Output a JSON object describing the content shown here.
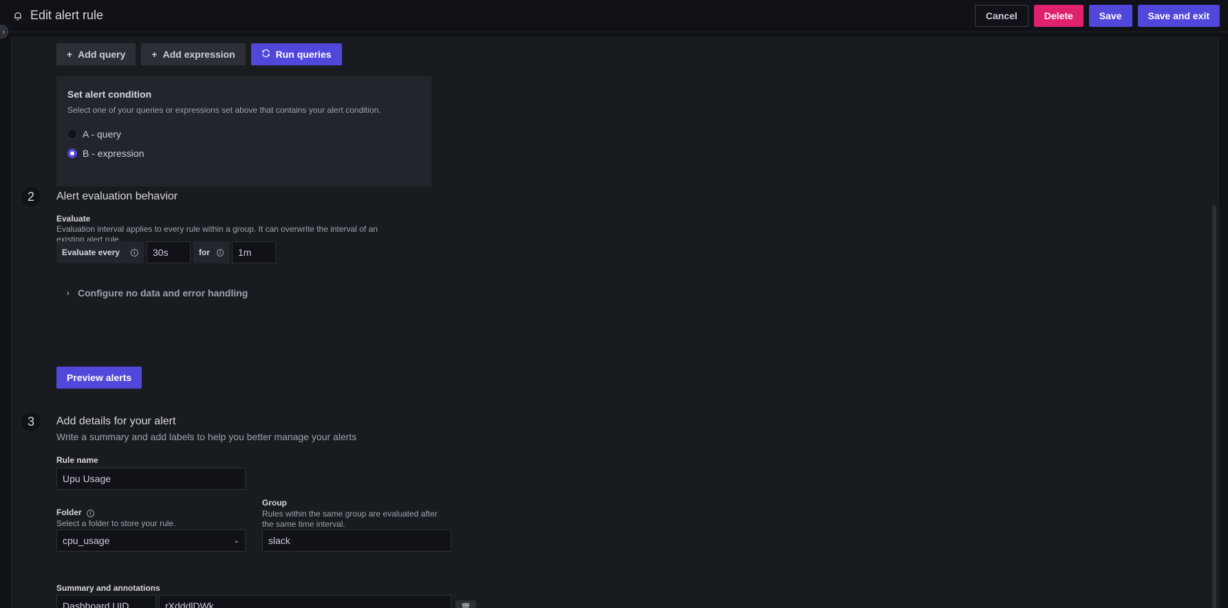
{
  "header": {
    "title": "Edit alert rule",
    "cancel": "Cancel",
    "delete": "Delete",
    "save": "Save",
    "save_exit": "Save and exit"
  },
  "colors": {
    "primary": "#5147da",
    "danger": "#e0226e"
  },
  "queries": {
    "add_query": "Add query",
    "add_expression": "Add expression",
    "run_queries": "Run queries"
  },
  "condition": {
    "title": "Set alert condition",
    "description": "Select one of your queries or expressions set above that contains your alert condition.",
    "options": [
      {
        "label": "A - query",
        "checked": false
      },
      {
        "label": "B - expression",
        "checked": true
      }
    ]
  },
  "step2": {
    "number": "2",
    "title": "Alert evaluation behavior",
    "evaluate_label": "Evaluate",
    "evaluate_desc_line1": "Evaluation interval applies to every rule within a group. It can overwrite the interval of an",
    "evaluate_desc_line2": "existing alert rule.",
    "evaluate_every_label": "Evaluate every",
    "evaluate_every_value": "30s",
    "for_label": "for",
    "for_value": "1m",
    "configure_label": "Configure no data and error handling",
    "preview_button": "Preview alerts"
  },
  "step3": {
    "number": "3",
    "title": "Add details for your alert",
    "subtitle": "Write a summary and add labels to help you better manage your alerts",
    "rule_name_label": "Rule name",
    "rule_name_value": "Upu Usage",
    "folder_label": "Folder",
    "folder_desc": "Select a folder to store your rule.",
    "folder_value": "cpu_usage",
    "group_label": "Group",
    "group_desc_line1": "Rules within the same group are evaluated after",
    "group_desc_line2": "the same time interval.",
    "group_value": "slack",
    "summary_label": "Summary and annotations",
    "annotation_key": "Dashboard UID",
    "annotation_value": "rXdddlDWk"
  }
}
